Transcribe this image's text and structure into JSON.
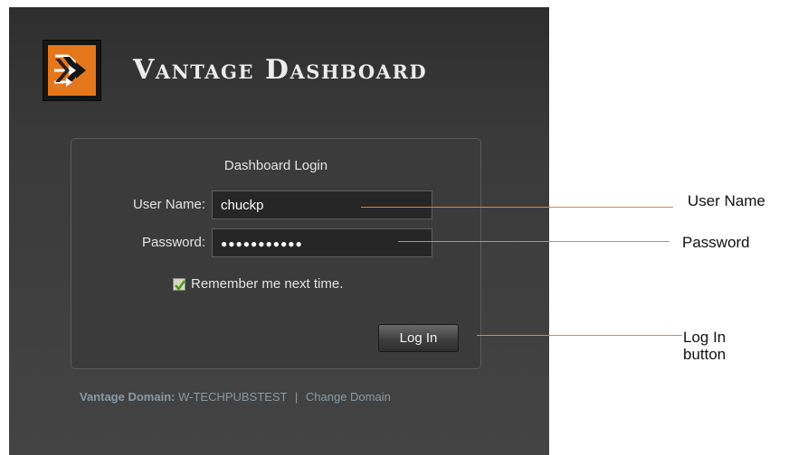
{
  "app": {
    "title": "Vantage Dashboard",
    "logo_icon": "double-arrow-logo-icon"
  },
  "login": {
    "heading": "Dashboard Login",
    "username_label": "User Name:",
    "username_value": "chuckp",
    "password_label": "Password:",
    "password_value": "●●●●●●●●●●●",
    "remember_label": "Remember me next time.",
    "remember_checked": true,
    "login_button": "Log In"
  },
  "domain": {
    "label": "Vantage Domain:",
    "value": "W-TECHPUBSTEST",
    "separator": "|",
    "change_link": "Change Domain"
  },
  "callouts": {
    "user_name": "User Name",
    "password": "Password",
    "log_in_line1": "Log In",
    "log_in_line2": "button"
  },
  "colors": {
    "accent_orange": "#e08a2a",
    "panel_bg": "#3a3a3a"
  }
}
